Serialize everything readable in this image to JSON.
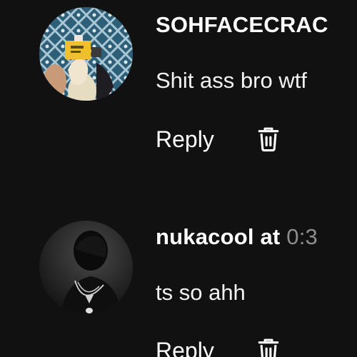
{
  "comments": [
    {
      "author": "SOHFACECRAC",
      "timestamp": "",
      "text": "Shit ass bro wtf",
      "reply_label": "Reply",
      "delete_icon": "trash-icon",
      "avatar": "user-avatar-photo"
    },
    {
      "author": "nukacool at",
      "timestamp": "0:3",
      "text": "ts so ahh",
      "reply_label": "Reply",
      "delete_icon": "trash-icon",
      "avatar": "user-avatar-photo"
    }
  ],
  "colors": {
    "background": "#111111",
    "text": "#ffffff",
    "timestamp": "#8e8e8e"
  }
}
